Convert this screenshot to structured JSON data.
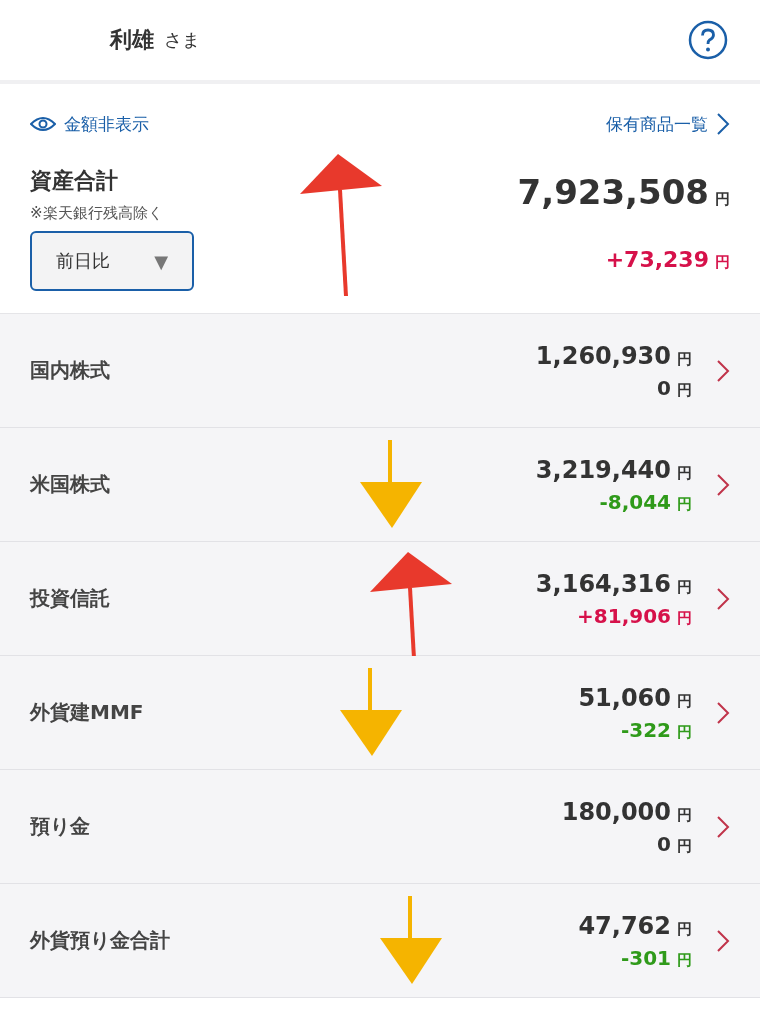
{
  "header": {
    "name": "利雄",
    "honorific": "さま"
  },
  "summary": {
    "hide_amounts": "金額非表示",
    "holdings_link": "保有商品一覧",
    "title": "資産合計",
    "note": "※楽天銀行残高除く",
    "period": {
      "value": "前日比",
      "caret": "▼"
    },
    "total": "7,923,508",
    "total_unit": "円",
    "change": "+73,239",
    "change_unit": "円",
    "color": "#d6114a",
    "marker": {
      "kind": "up",
      "color": "#e8392c"
    }
  },
  "rows": [
    {
      "label": "国内株式",
      "amount": "1,260,930",
      "amount_unit": "円",
      "change": "0",
      "change_unit": "円",
      "color": "#333333"
    },
    {
      "label": "米国株式",
      "amount": "3,219,440",
      "amount_unit": "円",
      "change": "-8,044",
      "change_unit": "円",
      "color": "#2f9a1a",
      "marker": {
        "kind": "down",
        "color": "#f5b400"
      }
    },
    {
      "label": "投資信託",
      "amount": "3,164,316",
      "amount_unit": "円",
      "change": "+81,906",
      "change_unit": "円",
      "color": "#d6114a",
      "marker": {
        "kind": "up",
        "color": "#e8392c"
      }
    },
    {
      "label": "外貨建MMF",
      "amount": "51,060",
      "amount_unit": "円",
      "change": "-322",
      "change_unit": "円",
      "color": "#2f9a1a",
      "marker": {
        "kind": "down",
        "color": "#f5b400"
      }
    },
    {
      "label": "預り金",
      "amount": "180,000",
      "amount_unit": "円",
      "change": "0",
      "change_unit": "円",
      "color": "#333333"
    },
    {
      "label": "外貨預り金合計",
      "amount": "47,762",
      "amount_unit": "円",
      "change": "-301",
      "change_unit": "円",
      "color": "#2f9a1a",
      "marker": {
        "kind": "down",
        "color": "#f5b400"
      }
    }
  ]
}
